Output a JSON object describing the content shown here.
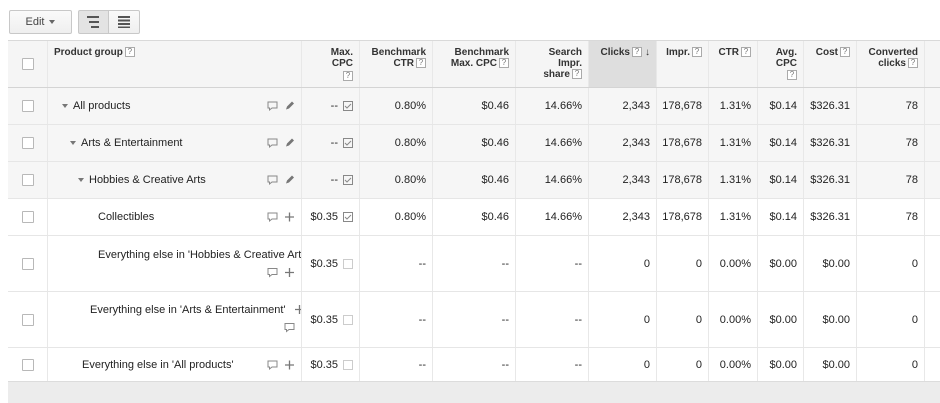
{
  "toolbar": {
    "edit_label": "Edit"
  },
  "headers": {
    "product_group": "Product group",
    "max_cpc": "Max. CPC",
    "benchmark_ctr_l1": "Benchmark",
    "benchmark_ctr_l2": "CTR",
    "benchmark_cpc_l1": "Benchmark",
    "benchmark_cpc_l2": "Max. CPC",
    "search_share_l1": "Search Impr.",
    "search_share_l2": "share",
    "clicks": "Clicks",
    "impr": "Impr.",
    "ctr": "CTR",
    "avg_cpc_l1": "Avg.",
    "avg_cpc_l2": "CPC",
    "cost": "Cost",
    "converted_l1": "Converted",
    "converted_l2": "clicks",
    "help_mark": "?",
    "sort_arrow": "↓"
  },
  "rows": [
    {
      "name": "All products",
      "max_cpc": "--",
      "bench_ctr": "0.80%",
      "bench_cpc": "$0.46",
      "share": "14.66%",
      "clicks": "2,343",
      "impr": "178,678",
      "ctr": "1.31%",
      "avg_cpc": "$0.14",
      "cost": "$326.31",
      "converted": "78"
    },
    {
      "name": "Arts & Entertainment",
      "max_cpc": "--",
      "bench_ctr": "0.80%",
      "bench_cpc": "$0.46",
      "share": "14.66%",
      "clicks": "2,343",
      "impr": "178,678",
      "ctr": "1.31%",
      "avg_cpc": "$0.14",
      "cost": "$326.31",
      "converted": "78"
    },
    {
      "name": "Hobbies & Creative Arts",
      "max_cpc": "--",
      "bench_ctr": "0.80%",
      "bench_cpc": "$0.46",
      "share": "14.66%",
      "clicks": "2,343",
      "impr": "178,678",
      "ctr": "1.31%",
      "avg_cpc": "$0.14",
      "cost": "$326.31",
      "converted": "78"
    },
    {
      "name": "Collectibles",
      "max_cpc": "$0.35",
      "bench_ctr": "0.80%",
      "bench_cpc": "$0.46",
      "share": "14.66%",
      "clicks": "2,343",
      "impr": "178,678",
      "ctr": "1.31%",
      "avg_cpc": "$0.14",
      "cost": "$326.31",
      "converted": "78"
    },
    {
      "name": "Everything else in 'Hobbies & Creative Arts'",
      "max_cpc": "$0.35",
      "bench_ctr": "--",
      "bench_cpc": "--",
      "share": "--",
      "clicks": "0",
      "impr": "0",
      "ctr": "0.00%",
      "avg_cpc": "$0.00",
      "cost": "$0.00",
      "converted": "0"
    },
    {
      "name": "Everything else in 'Arts & Entertainment'",
      "max_cpc": "$0.35",
      "bench_ctr": "--",
      "bench_cpc": "--",
      "share": "--",
      "clicks": "0",
      "impr": "0",
      "ctr": "0.00%",
      "avg_cpc": "$0.00",
      "cost": "$0.00",
      "converted": "0"
    },
    {
      "name": "Everything else in 'All products'",
      "max_cpc": "$0.35",
      "bench_ctr": "--",
      "bench_cpc": "--",
      "share": "--",
      "clicks": "0",
      "impr": "0",
      "ctr": "0.00%",
      "avg_cpc": "$0.00",
      "cost": "$0.00",
      "converted": "0"
    }
  ],
  "icons": {
    "comment": "comment-icon",
    "pencil": "pencil-icon",
    "plus": "plus-icon",
    "edit_bid": "edit-bid-icon",
    "expand": "expand-triangle-icon"
  },
  "colors": {
    "header_bg": "#f5f5f5",
    "sorted_header_bg": "#dedede",
    "grey_row_bg": "#f6f6f6"
  }
}
